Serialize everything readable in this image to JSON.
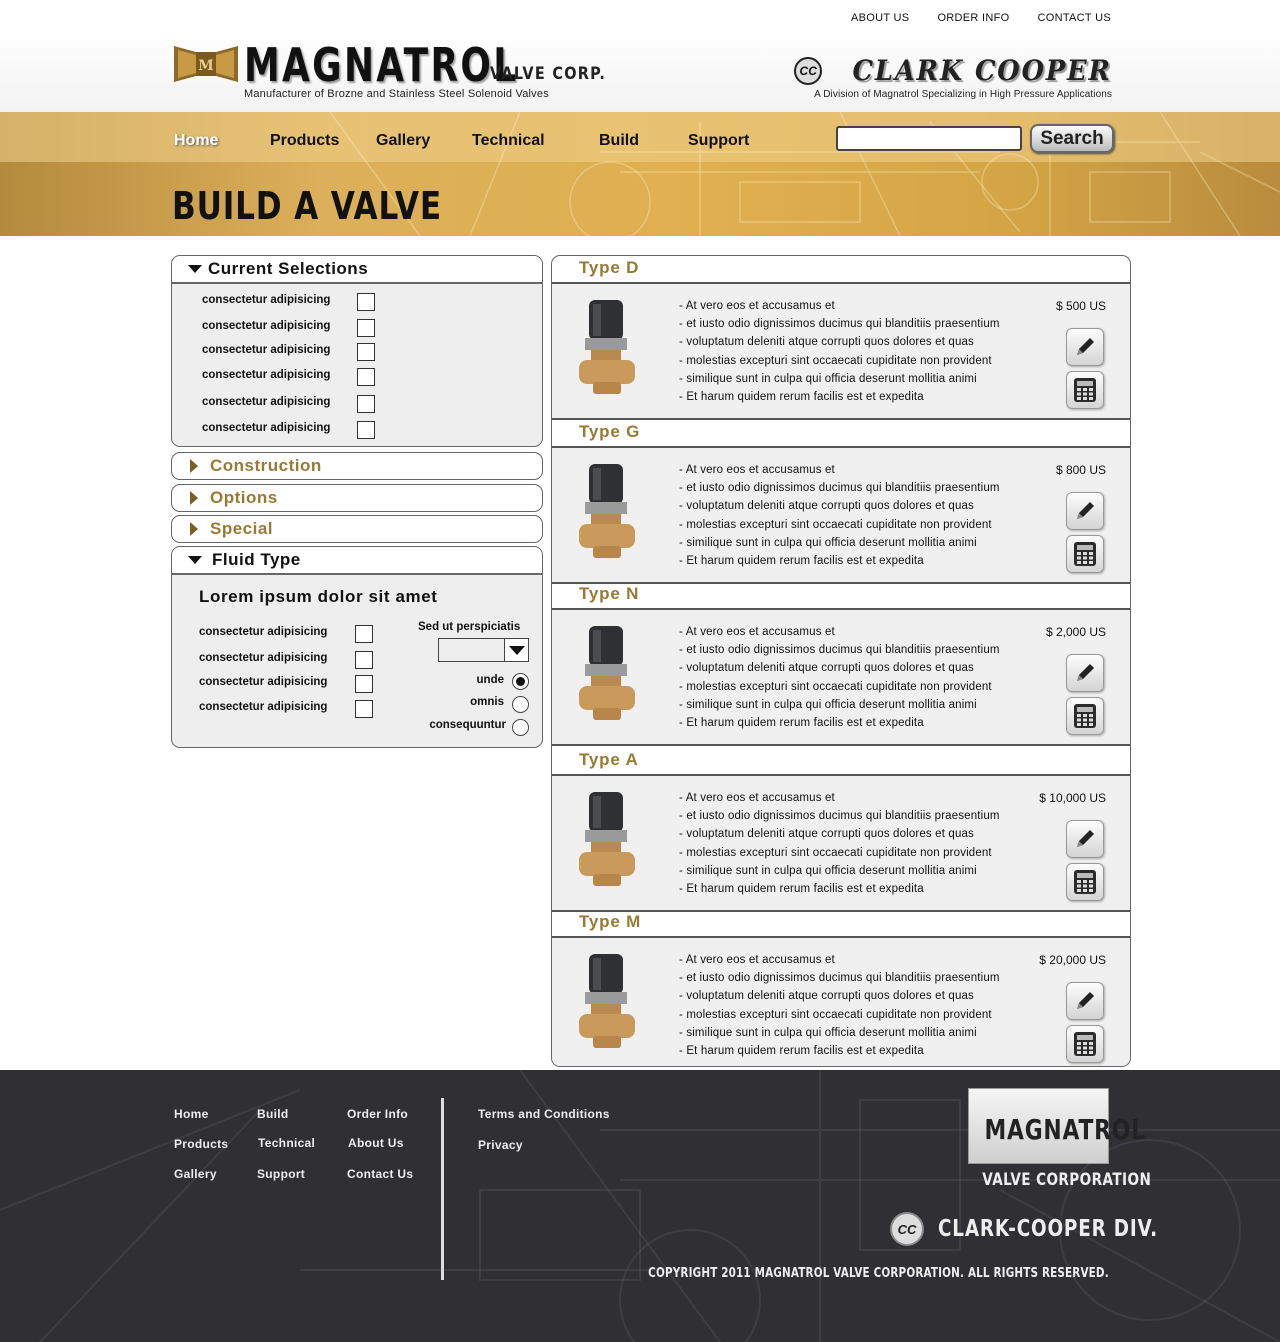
{
  "util_links": [
    "ABOUT US",
    "ORDER INFO",
    "CONTACT US"
  ],
  "brand": {
    "name": "MAGNATROL",
    "suffix": "VALVE CORP.",
    "tagline": "Manufacturer of Brozne and Stainless Steel Solenoid Valves",
    "division_name": "CLARK COOPER",
    "division_badge": "CC",
    "division_tagline": "A Division of Magnatrol Specializing in High Pressure Applications"
  },
  "nav": {
    "items": [
      "Home",
      "Products",
      "Gallery",
      "Technical",
      "Build",
      "Support"
    ],
    "active": "Home",
    "search_label": "Search",
    "search_value": ""
  },
  "page_title": "BUILD A VALVE",
  "current_selections": {
    "title": "Current Selections",
    "items": [
      "consectetur adipisicing",
      "consectetur adipisicing",
      "consectetur adipisicing",
      "consectetur adipisicing",
      "consectetur adipisicing",
      "consectetur adipisicing"
    ]
  },
  "collapsed_sections": [
    "Construction",
    "Options",
    "Special"
  ],
  "fluid_type": {
    "title": "Fluid Type",
    "heading": "Lorem ipsum dolor sit amet",
    "checks": [
      "consectetur adipisicing",
      "consectetur adipisicing",
      "consectetur adipisicing",
      "consectetur adipisicing"
    ],
    "select_label": "Sed ut perspiciatis",
    "select_value": "",
    "radios": [
      {
        "label": "unde",
        "checked": true
      },
      {
        "label": "omnis",
        "checked": false
      },
      {
        "label": "consequuntur",
        "checked": false
      }
    ]
  },
  "products": [
    {
      "title": "Type D",
      "price": "$ 500 US",
      "lines": [
        "- At vero eos et accusamus et",
        "- et iusto odio dignissimos ducimus qui blanditiis praesentium",
        "- voluptatum deleniti atque corrupti quos dolores et quas",
        "- molestias excepturi sint occaecati cupiditate non provident",
        "- similique sunt in culpa qui officia deserunt mollitia animi",
        "- Et harum quidem rerum facilis est et expedita"
      ]
    },
    {
      "title": "Type G",
      "price": "$ 800 US",
      "lines": [
        "- At vero eos et accusamus et",
        "- et iusto odio dignissimos ducimus qui blanditiis praesentium",
        "- voluptatum deleniti atque corrupti quos dolores et quas",
        "- molestias excepturi sint occaecati cupiditate non provident",
        "- similique sunt in culpa qui officia deserunt mollitia animi",
        "- Et harum quidem rerum facilis est et expedita"
      ]
    },
    {
      "title": "Type N",
      "price": "$ 2,000 US",
      "lines": [
        "- At vero eos et accusamus et",
        "- et iusto odio dignissimos ducimus qui blanditiis praesentium",
        "- voluptatum deleniti atque corrupti quos dolores et quas",
        "- molestias excepturi sint occaecati cupiditate non provident",
        "- similique sunt in culpa qui officia deserunt mollitia animi",
        "- Et harum quidem rerum facilis est et expedita"
      ]
    },
    {
      "title": "Type A",
      "price": "$ 10,000 US",
      "lines": [
        "- At vero eos et accusamus et",
        "- et iusto odio dignissimos ducimus qui blanditiis praesentium",
        "- voluptatum deleniti atque corrupti quos dolores et quas",
        "- molestias excepturi sint occaecati cupiditate non provident",
        "- similique sunt in culpa qui officia deserunt mollitia animi",
        "- Et harum quidem rerum facilis est et expedita"
      ]
    },
    {
      "title": "Type M",
      "price": "$ 20,000 US",
      "lines": [
        "- At vero eos et accusamus et",
        "- et iusto odio dignissimos ducimus qui blanditiis praesentium",
        "- voluptatum deleniti atque corrupti quos dolores et quas",
        "- molestias excepturi sint occaecati cupiditate non provident",
        "- similique sunt in culpa qui officia deserunt mollitia animi",
        "- Et harum quidem rerum facilis est et expedita"
      ]
    }
  ],
  "product_icons": [
    "pencil-icon",
    "calculator-icon"
  ],
  "footer": {
    "col1": [
      "Home",
      "Products",
      "Gallery"
    ],
    "col2": [
      "Build",
      "Technical",
      "Support"
    ],
    "col3": [
      "Order Info",
      "About Us",
      "Contact Us"
    ],
    "col4": [
      "Terms and Conditions",
      "Privacy"
    ],
    "logo_word": "MAGNATROL",
    "logo_sub": "VALVE CORPORATION",
    "division_badge": "CC",
    "division": "CLARK-COOPER DIV.",
    "copyright": "COPYRIGHT 2011 MAGNATROL VALVE CORPORATION. ALL RIGHTS RESERVED."
  },
  "colors": {
    "gold": "#dcb05a",
    "section_gold": "#987a34",
    "footer_bg": "#2f2f34"
  }
}
